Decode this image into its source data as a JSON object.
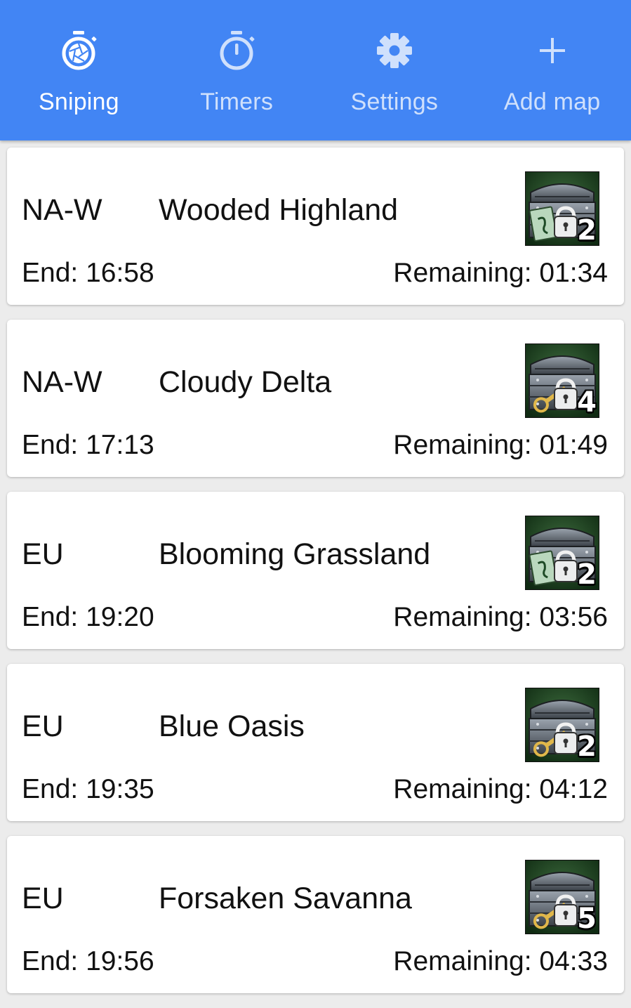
{
  "nav": {
    "tabs": [
      {
        "label": "Sniping",
        "icon": "aperture-timer-icon",
        "active": true
      },
      {
        "label": "Timers",
        "icon": "stopwatch-icon",
        "active": false
      },
      {
        "label": "Settings",
        "icon": "gear-icon",
        "active": false
      },
      {
        "label": "Add map",
        "icon": "plus-icon",
        "active": false
      }
    ]
  },
  "maps": [
    {
      "region": "NA-W",
      "name": "Wooded Highland",
      "end": "End: 16:58",
      "remaining": "Remaining: 01:34",
      "chest_count": "2",
      "chest_key": "card-scroll"
    },
    {
      "region": "NA-W",
      "name": "Cloudy Delta",
      "end": "End: 17:13",
      "remaining": "Remaining: 01:49",
      "chest_count": "4",
      "chest_key": "golden-key"
    },
    {
      "region": "EU",
      "name": "Blooming Grassland",
      "end": "End: 19:20",
      "remaining": "Remaining: 03:56",
      "chest_count": "2",
      "chest_key": "card-scroll"
    },
    {
      "region": "EU",
      "name": "Blue Oasis",
      "end": "End: 19:35",
      "remaining": "Remaining: 04:12",
      "chest_count": "2",
      "chest_key": "golden-key"
    },
    {
      "region": "EU",
      "name": "Forsaken Savanna",
      "end": "End: 19:56",
      "remaining": "Remaining: 04:33",
      "chest_count": "5",
      "chest_key": "golden-key"
    }
  ],
  "colors": {
    "header": "#4285f4",
    "card": "#ffffff",
    "background": "#ececec",
    "text": "#111111"
  }
}
